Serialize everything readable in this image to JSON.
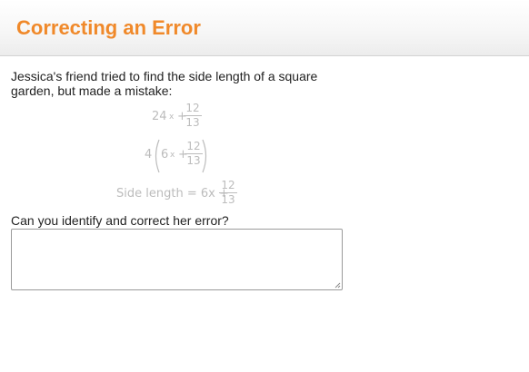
{
  "header": {
    "title": "Correcting an Error"
  },
  "problem": {
    "prompt_line1": "Jessica's friend tried to find the side length of a square",
    "prompt_line2": "garden, but made a mistake:",
    "step1": {
      "lead": "24",
      "op1": "x",
      "op2": "+",
      "frac_num": "12",
      "frac_den": "13"
    },
    "step2": {
      "lead": "4",
      "inner": "6",
      "op1": "x",
      "op2": "+",
      "frac_num": "12",
      "frac_den": "13"
    },
    "step3": {
      "text": "Side length = 6x +",
      "frac_num": "12",
      "frac_den": "13"
    },
    "question": "Can you identify and correct her error?"
  },
  "answer": {
    "value": "",
    "placeholder": ""
  },
  "colors": {
    "title": "#f0892a",
    "math": "#bcbcbc",
    "text": "#222222"
  }
}
